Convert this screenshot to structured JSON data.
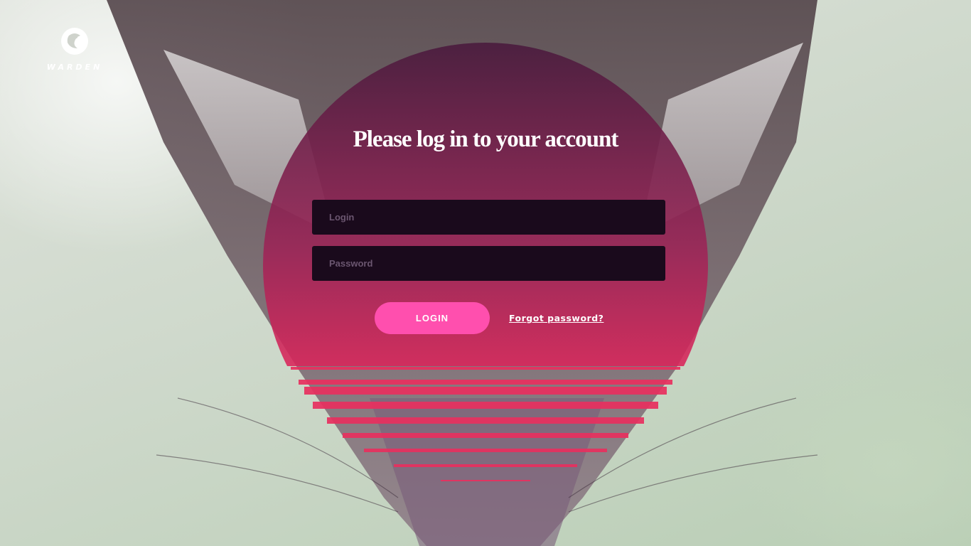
{
  "brand": {
    "name": "WARDEN",
    "logo_icon": "warden-bird-icon"
  },
  "form": {
    "title": "Please log in to your account",
    "login_placeholder": "Login",
    "password_placeholder": "Password",
    "login_button": "LOGIN",
    "forgot_link": "Forgot password?"
  },
  "colors": {
    "accent": "#ff4fae",
    "circle_top": "#5a1f48",
    "circle_bottom": "#e0245a",
    "field_bg": "#1a0a1c"
  }
}
